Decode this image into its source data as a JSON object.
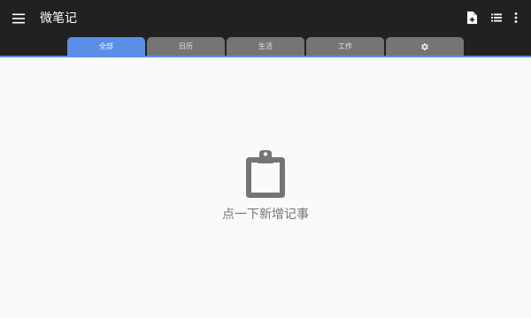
{
  "app": {
    "title": "微笔记"
  },
  "header": {
    "menu_icon": "hamburger-menu-icon",
    "actions": [
      {
        "name": "new-note",
        "icon": "note-add-icon"
      },
      {
        "name": "list-view",
        "icon": "list-view-icon"
      },
      {
        "name": "more",
        "icon": "more-vert-icon"
      }
    ]
  },
  "tabs": [
    {
      "label": "全部",
      "active": true
    },
    {
      "label": "日历",
      "active": false
    },
    {
      "label": "生活",
      "active": false
    },
    {
      "label": "工作",
      "active": false
    },
    {
      "label": "",
      "icon": "gear-icon",
      "active": false
    }
  ],
  "empty_state": {
    "icon": "clipboard-icon",
    "text": "点一下新增记事"
  },
  "colors": {
    "appbar": "#212121",
    "accent": "#5b8ee6",
    "tab_inactive": "#757575",
    "background": "#fafafa",
    "empty_icon": "#757575"
  }
}
